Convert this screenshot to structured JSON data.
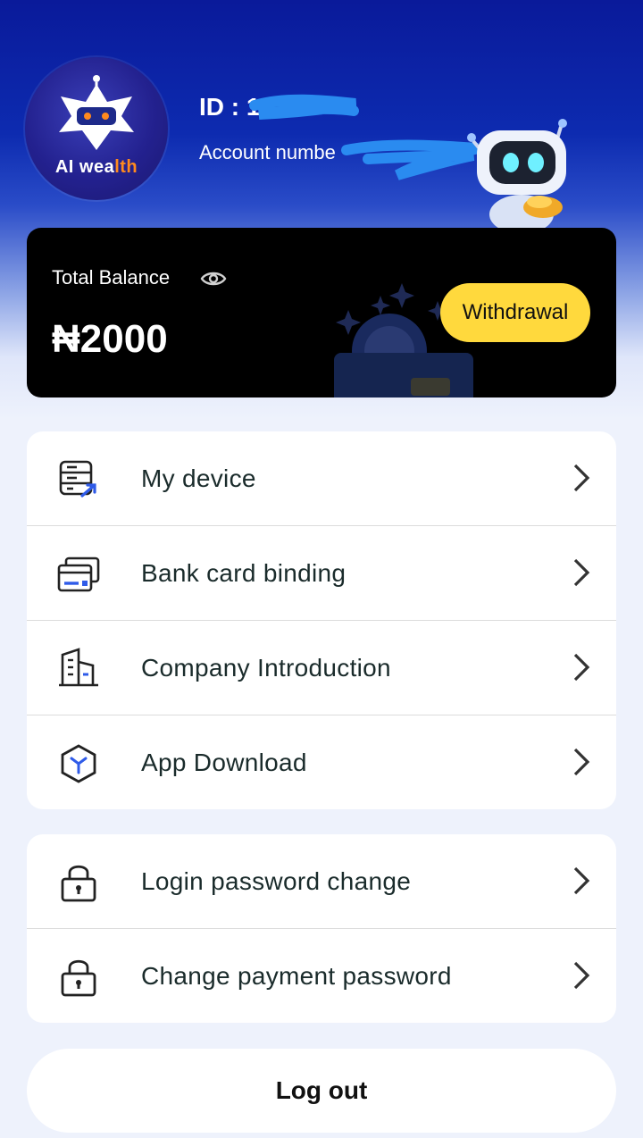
{
  "header": {
    "logo_text_main": "AI wea",
    "logo_text_accent": "lth",
    "id_label": "ID : 1",
    "account_label": "Account numbe"
  },
  "balance": {
    "label": "Total Balance",
    "amount": "₦2000",
    "withdraw_label": "Withdrawal"
  },
  "menu_group_1": [
    {
      "label": "My device",
      "icon": "server-icon"
    },
    {
      "label": "Bank card binding",
      "icon": "bank-card-icon"
    },
    {
      "label": "Company Introduction",
      "icon": "building-icon"
    },
    {
      "label": "App Download",
      "icon": "cube-icon"
    }
  ],
  "menu_group_2": [
    {
      "label": "Login password change",
      "icon": "lock-icon"
    },
    {
      "label": "Change payment password",
      "icon": "lock-icon"
    }
  ],
  "logout_label": "Log out",
  "colors": {
    "header_blue": "#0d2bb0",
    "accent_yellow": "#ffd93d",
    "icon_blue": "#2f5be8",
    "logo_orange": "#ff8a1e"
  }
}
